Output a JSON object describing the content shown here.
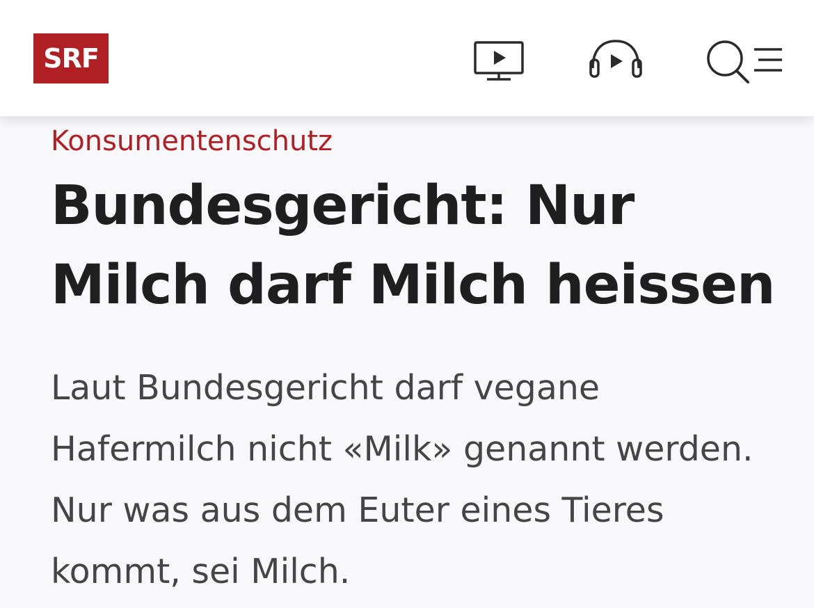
{
  "header": {
    "logo_text": "SRF",
    "brand_color": "#af1f24",
    "icons": [
      "tv-play-icon",
      "headphones-play-icon",
      "search-icon",
      "menu-icon"
    ]
  },
  "article": {
    "kicker": "Konsumentenschutz",
    "title": "Bundesgericht: Nur Milch darf Milch heissen",
    "lead": "Laut Bundesgericht darf vegane Hafermilch nicht «Milk» genannt werden. Nur was aus dem Euter eines Tieres kommt, sei Milch.",
    "kicker_color": "#af1f24"
  }
}
